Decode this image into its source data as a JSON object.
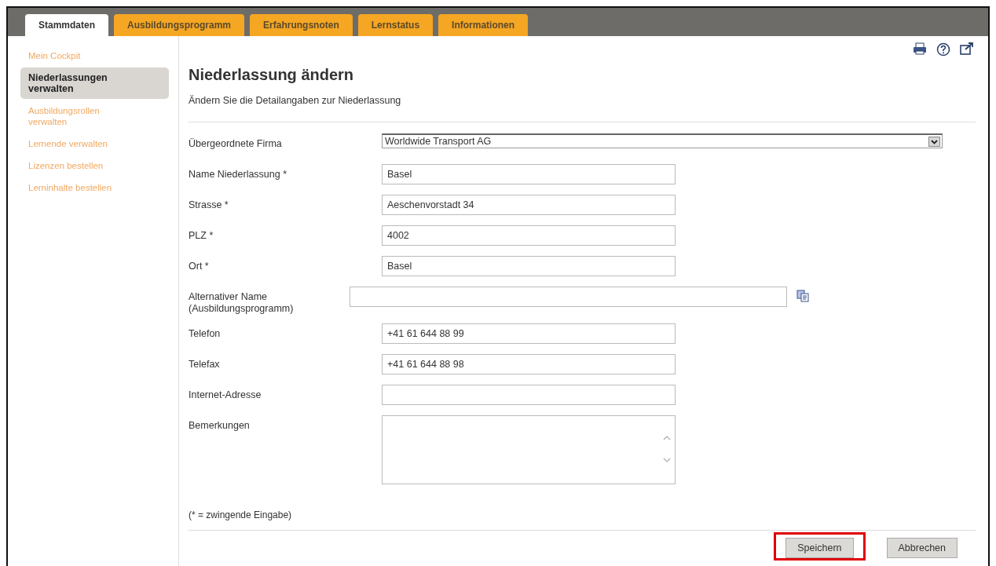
{
  "tabs": [
    {
      "label": "Stammdaten",
      "selected": true
    },
    {
      "label": "Ausbildungsprogramm",
      "selected": false
    },
    {
      "label": "Erfahrungsnoten",
      "selected": false
    },
    {
      "label": "Lernstatus",
      "selected": false
    },
    {
      "label": "Informationen",
      "selected": false
    }
  ],
  "sidebar": {
    "items": [
      {
        "label": "Mein Cockpit",
        "selected": false
      },
      {
        "label": "Niederlassungen verwalten",
        "selected": true
      },
      {
        "label": "Ausbildungsrollen verwalten",
        "selected": false
      },
      {
        "label": "Lernende verwalten",
        "selected": false
      },
      {
        "label": "Lizenzen bestellen",
        "selected": false
      },
      {
        "label": "Lerninhalte bestellen",
        "selected": false
      }
    ]
  },
  "page": {
    "title": "Niederlassung ändern",
    "subtitle": "Ändern Sie die Detailangaben zur Niederlassung"
  },
  "fields": [
    {
      "kind": "select",
      "label": "Übergeordnete Firma",
      "value": "Worldwide Transport AG"
    },
    {
      "kind": "text",
      "label": "Name Niederlassung *",
      "value": "Basel"
    },
    {
      "kind": "text",
      "label": "Strasse *",
      "value": "Aeschenvorstadt 34"
    },
    {
      "kind": "text",
      "label": "PLZ *",
      "value": "4002"
    },
    {
      "kind": "text",
      "label": "Ort *",
      "value": "Basel"
    },
    {
      "kind": "wide",
      "label": "Alternativer Name (Ausbildungsprogramm)"
    },
    {
      "kind": "text",
      "label": "Telefon",
      "value": "+41 61 644 88 99"
    },
    {
      "kind": "text",
      "label": "Telefax",
      "value": "+41 61 644 88 98"
    },
    {
      "kind": "text",
      "label": "Internet-Adresse"
    },
    {
      "kind": "textarea",
      "label": "Bemerkungen"
    }
  ],
  "note": "(* = zwingende Eingabe)",
  "buttons": [
    {
      "label": "Speichern",
      "highlighted": true
    },
    {
      "label": "Abbrechen",
      "highlighted": false
    }
  ]
}
